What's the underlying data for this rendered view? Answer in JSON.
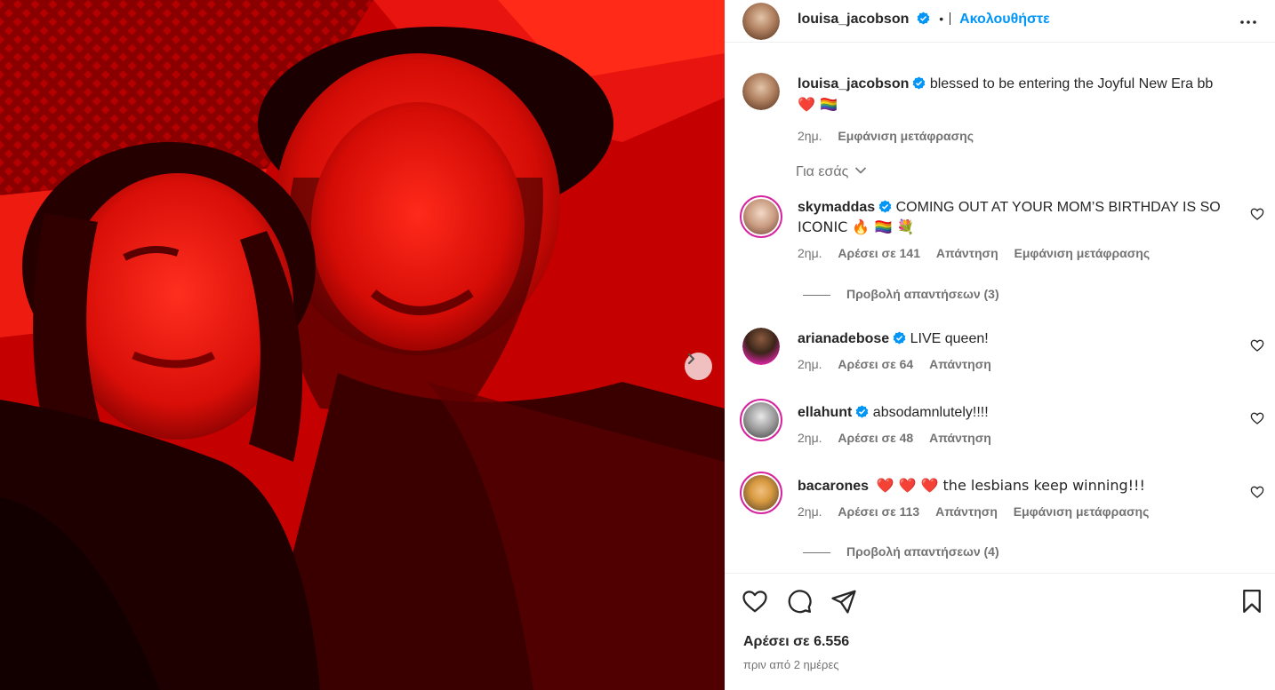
{
  "post": {
    "username": "louisa_jacobson",
    "separator": "•",
    "follow_label": "Ακολουθήστε",
    "caption_text": "blessed to be entering the Joyful New Era bb",
    "caption_emoji": "❤️ 🏳️‍🌈",
    "caption_time": "2ημ.",
    "caption_translate": "Εμφάνιση μετάφρασης",
    "for_you_label": "Για εσάς"
  },
  "comments": [
    {
      "username": "skymaddas",
      "text_line1": "COMING OUT AT YOUR MOM’S BIRTHDAY IS SO",
      "text_line2": "ICONIC 🔥 🏳️‍🌈 💐",
      "time": "2ημ.",
      "likes": "Αρέσει σε 141",
      "reply": "Απάντηση",
      "translate": "Εμφάνιση μετάφρασης",
      "view_replies": "Προβολή απαντήσεων (3)"
    },
    {
      "username": "arianadebose",
      "text_line1": "LIVE queen!",
      "time": "2ημ.",
      "likes": "Αρέσει σε 64",
      "reply": "Απάντηση"
    },
    {
      "username": "ellahunt",
      "text_line1": "absodamnlutely!!!!",
      "time": "2ημ.",
      "likes": "Αρέσει σε 48",
      "reply": "Απάντηση"
    },
    {
      "username": "bacarones",
      "text_line1": "❤️ ❤️ ❤️  the lesbians keep winning!!!",
      "time": "2ημ.",
      "likes": "Αρέσει σε 113",
      "reply": "Απάντηση",
      "translate": "Εμφάνιση μετάφρασης",
      "view_replies": "Προβολή απαντήσεων (4)"
    }
  ],
  "footer": {
    "likes_label": "Αρέσει σε 6.556",
    "posted_ago": "πριν από 2 ημέρες"
  },
  "icons": {
    "like": "heart-icon",
    "comment": "comment-icon",
    "share": "share-icon",
    "save": "bookmark-icon",
    "more": "more-options-icon",
    "next": "chevron-right-icon",
    "verified": "verified-badge-icon"
  },
  "colors": {
    "accent": "#0095f6",
    "verified": "#0095f6",
    "text": "#262626",
    "muted": "#737373",
    "heart_red": "#ed4956",
    "photo_red": "#d00000"
  }
}
